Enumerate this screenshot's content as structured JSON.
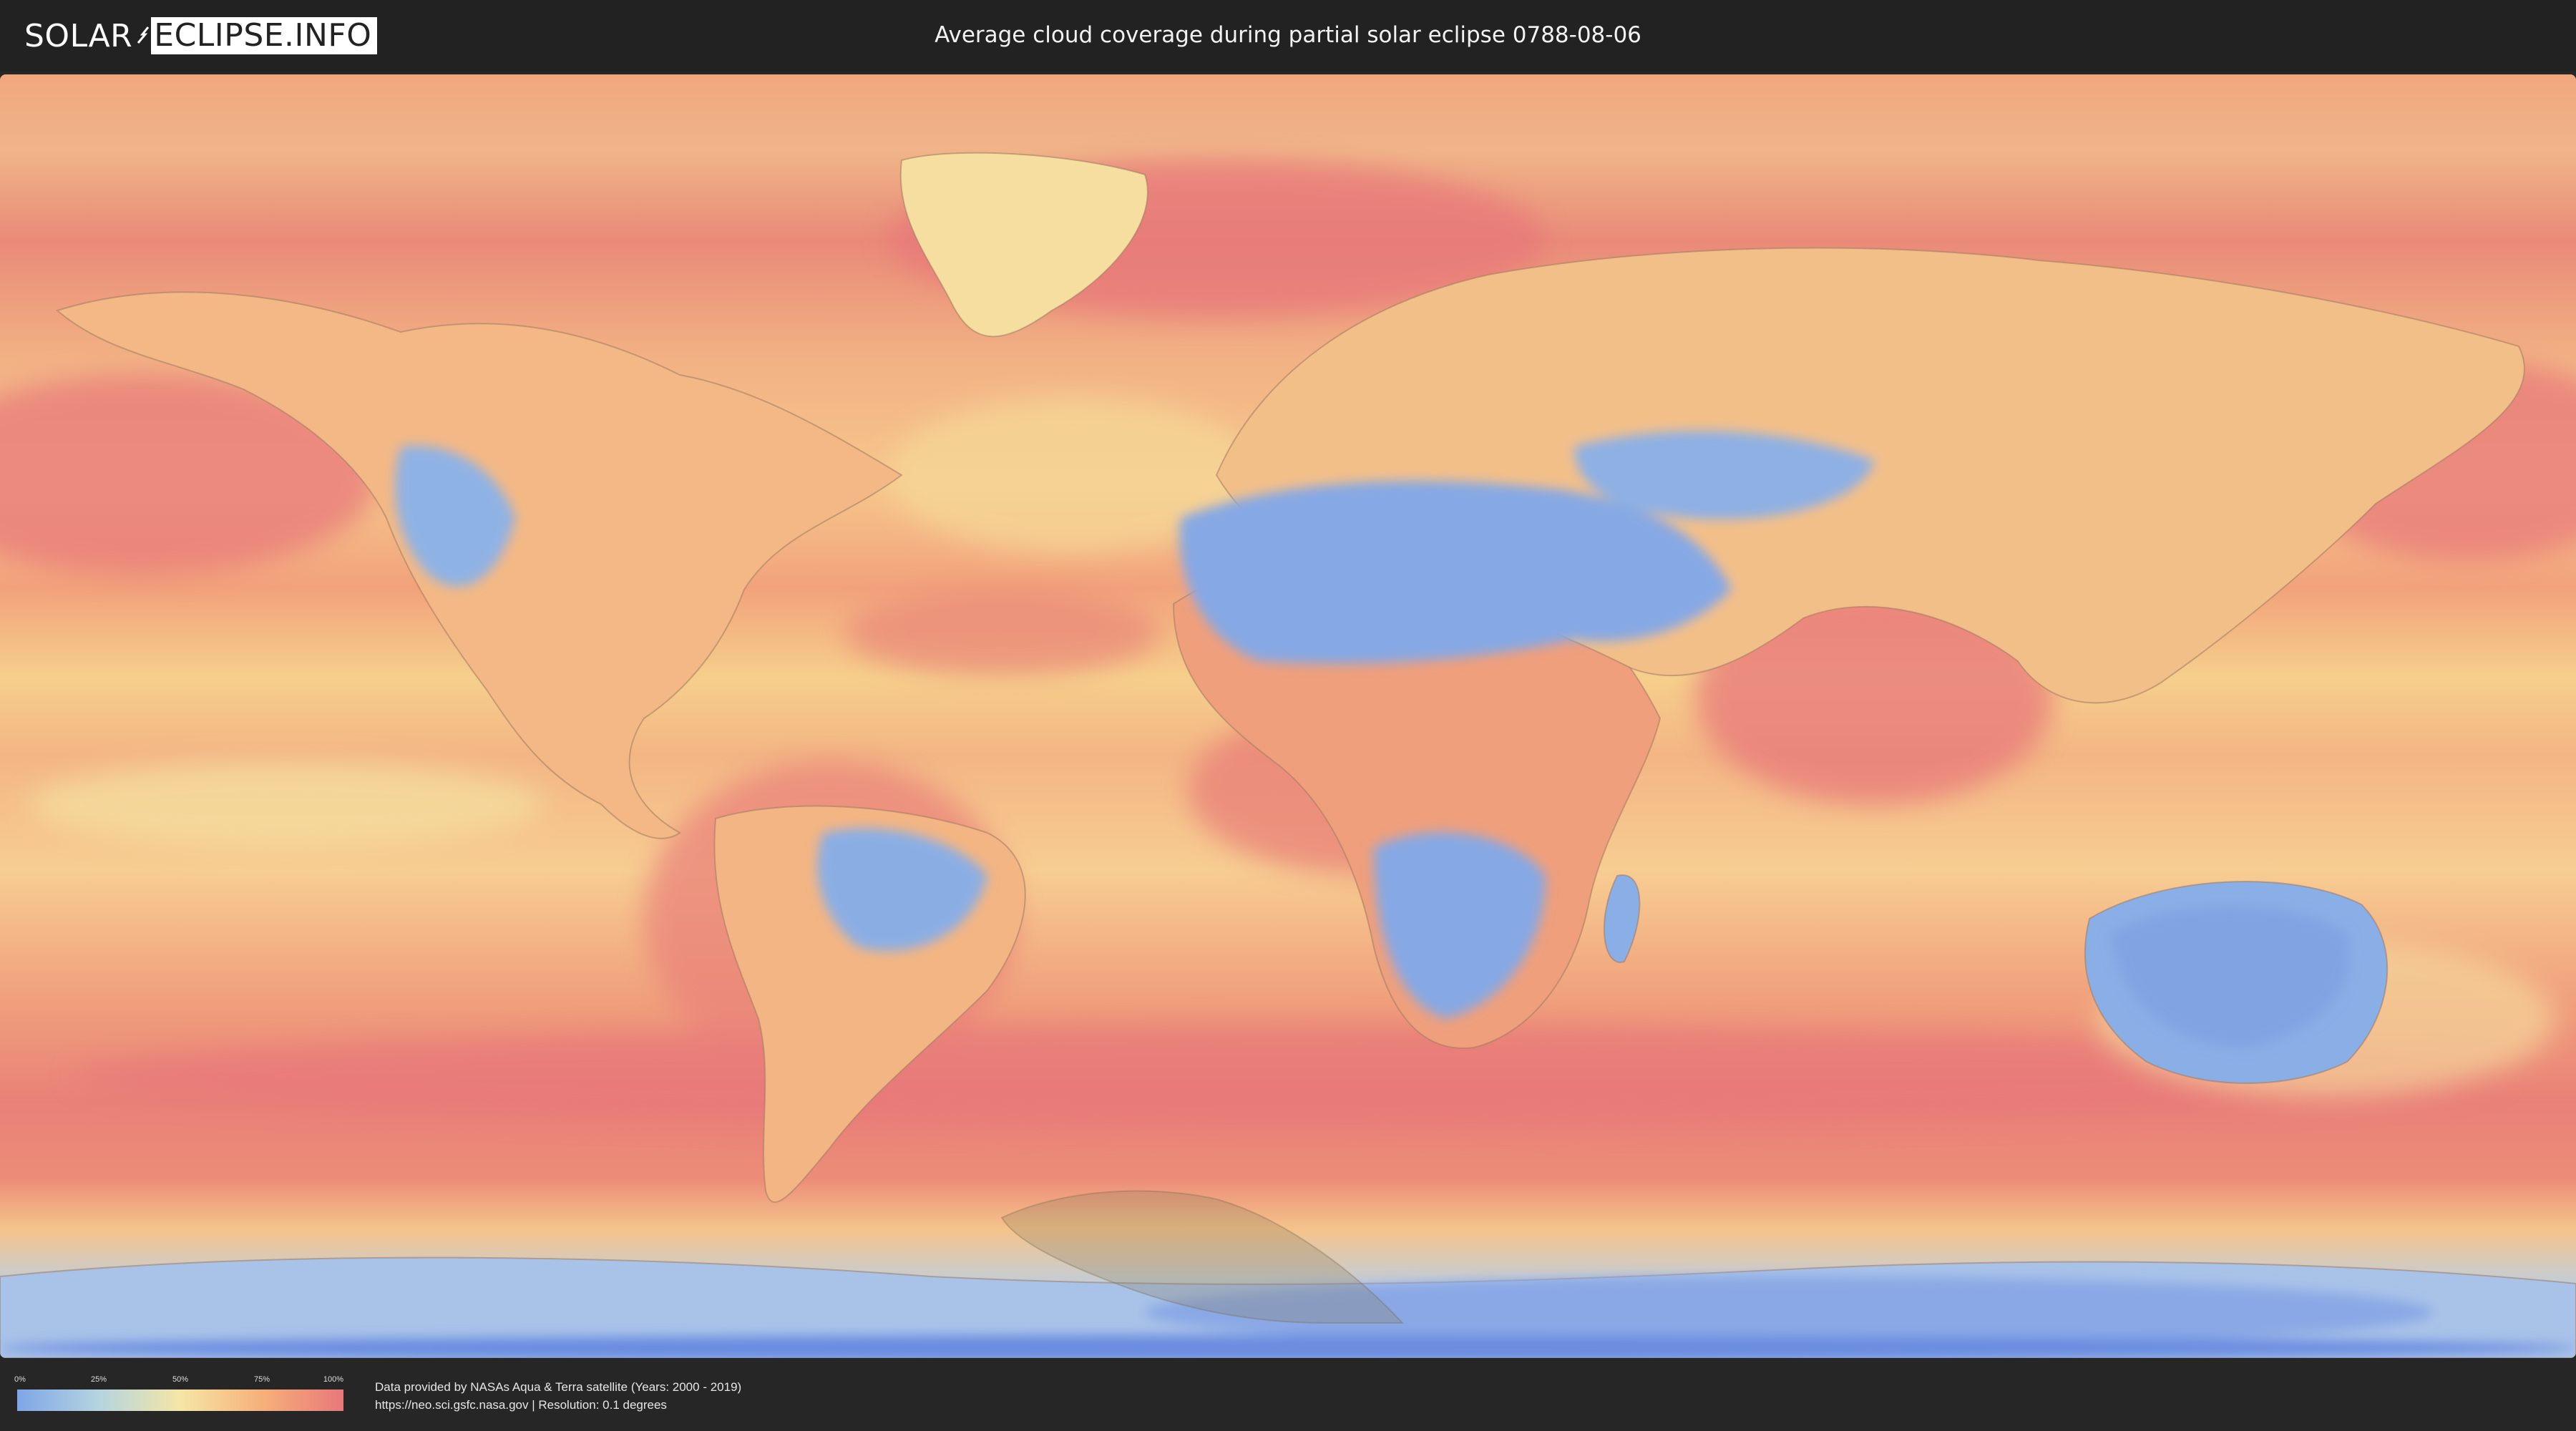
{
  "header": {
    "logo": {
      "part_a": "SOLAR",
      "part_b": "ECLIPSE.INFO"
    },
    "title": "Average cloud coverage during partial solar eclipse 0788-08-06"
  },
  "legend": {
    "ticks": [
      "0%",
      "25%",
      "50%",
      "75%",
      "100%"
    ],
    "colors": [
      "#7fa6e8",
      "#b4d4e0",
      "#f5e6a6",
      "#f6b07a",
      "#e8787a"
    ]
  },
  "credit": {
    "line1": "Data provided by NASAs Aqua & Terra satellite (Years: 2000 - 2019)",
    "line2": "https://neo.sci.gsfc.nasa.gov | Resolution: 0.1 degrees"
  },
  "map": {
    "colors": {
      "clear": "#7fa6e8",
      "low": "#b4d4e0",
      "mid": "#f5e0a0",
      "high": "#f2a77a",
      "overcast": "#e8787a",
      "eclipse": "#8a7a5a"
    }
  }
}
